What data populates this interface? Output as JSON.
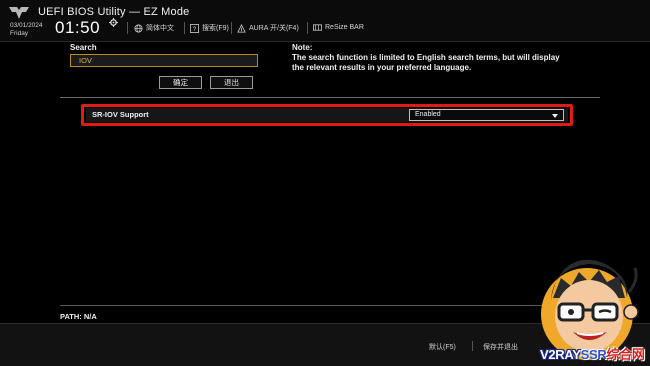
{
  "header": {
    "title": "UEFI BIOS Utility — EZ Mode",
    "date": "03/01/2024",
    "day": "Friday",
    "time": "01:50",
    "items": [
      {
        "icon": "globe-icon",
        "label": "简体中文"
      },
      {
        "icon": "question-icon",
        "label": "搜索(F9)"
      },
      {
        "icon": "aura-icon",
        "label": "AURA 开/关(F4)"
      },
      {
        "icon": "resize-bar-icon",
        "label": "ReSize BAR"
      }
    ]
  },
  "search": {
    "label": "Search",
    "value": "IOV",
    "confirm_label": "确定",
    "exit_label": "退出"
  },
  "note": {
    "title": "Note:",
    "text": "The search function is limited to English search terms, but will display the relevant results in your preferred language."
  },
  "result": {
    "label": "SR-IOV Support",
    "value": "Enabled",
    "highlight_color": "#e01b12"
  },
  "path": "PATH: N/A",
  "footer": {
    "default_label": "默认(F5)",
    "save_exit_label": "保存并退出"
  },
  "watermark": {
    "part1": "V2RAY",
    "part2": "SSR",
    "part3": "综合网"
  }
}
